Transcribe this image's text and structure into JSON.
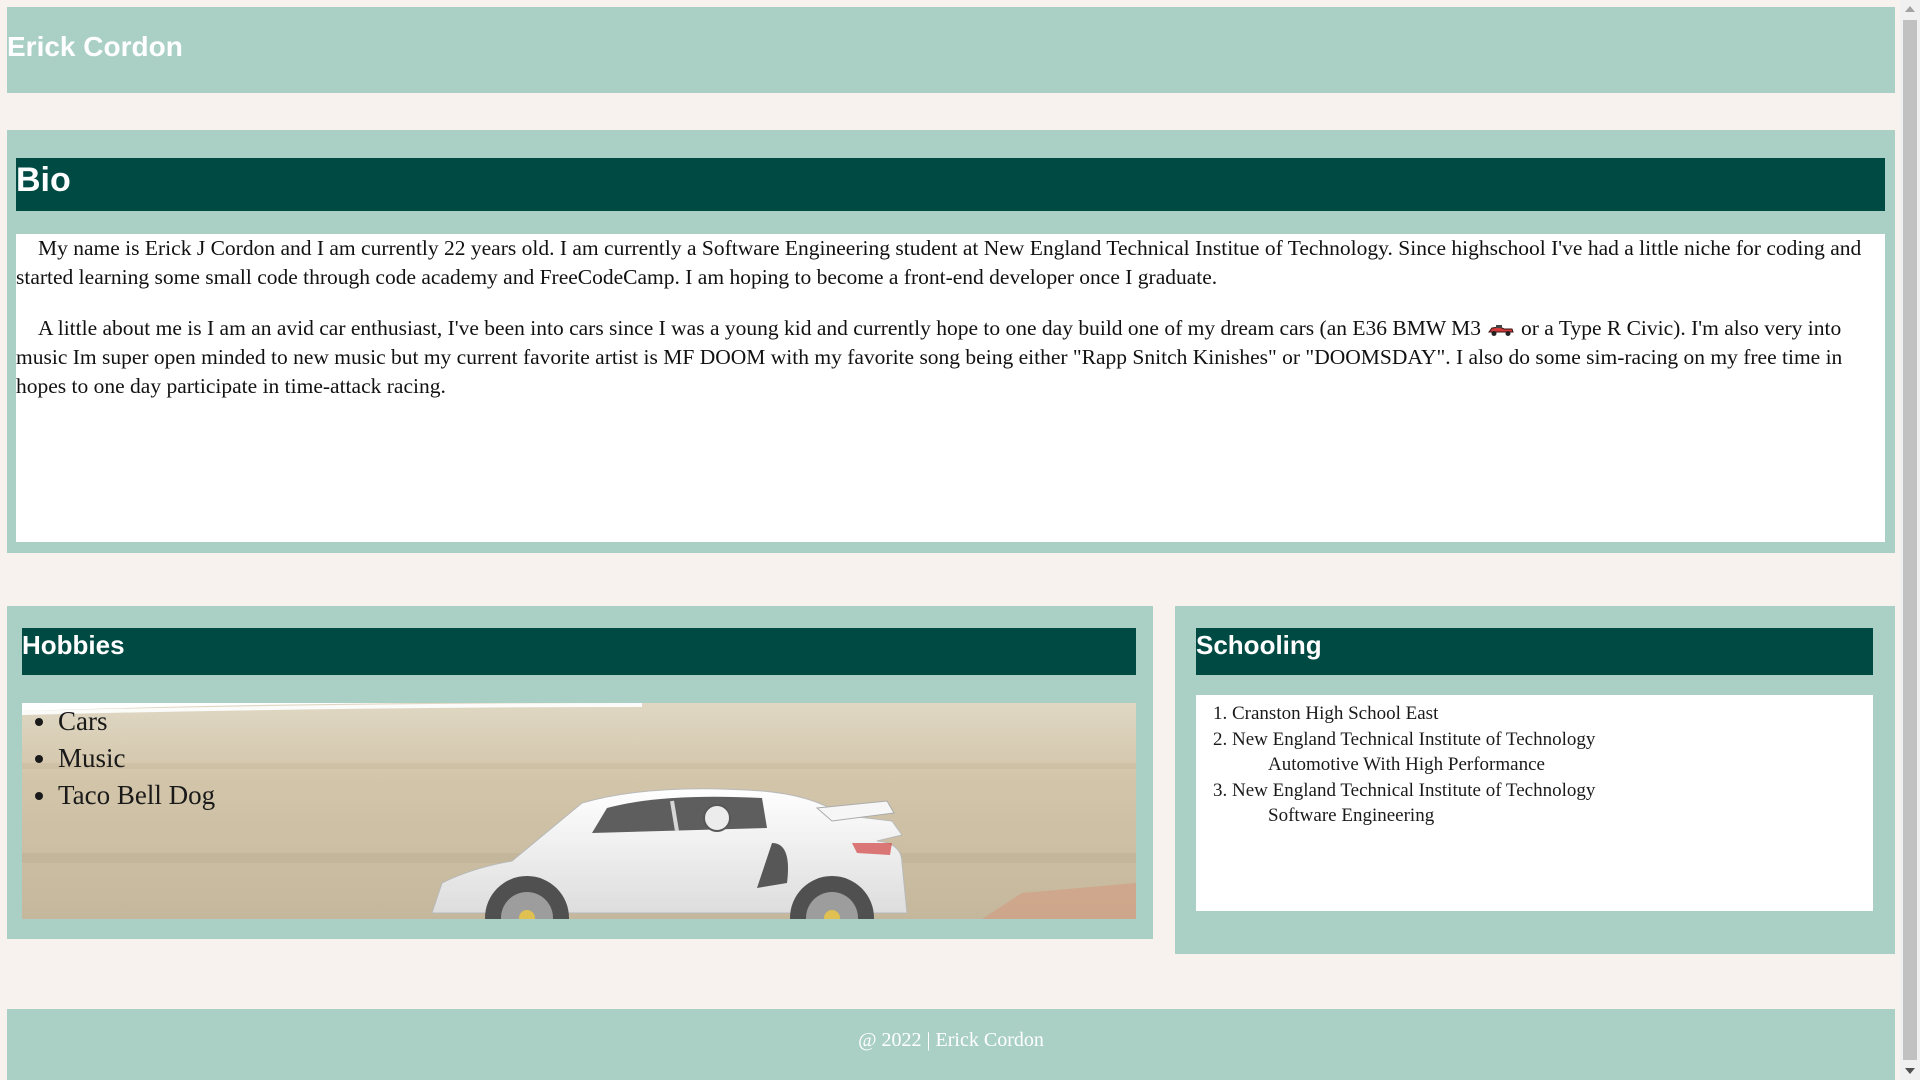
{
  "header": {
    "title": "Erick Cordon"
  },
  "bio": {
    "heading": "Bio",
    "paragraph1": "My name is Erick J Cordon and I am currently 22 years old. I am currently a Software Engineering student at New England Technical Institue of Technology. Since highschool I've had a little niche for coding and started learning some small code through code academy and FreeCodeCamp. I am hoping to become a front-end developer once I graduate.",
    "paragraph2_before": "A little about me is I am an avid car enthusiast, I've been into cars since I was a young kid and currently hope to one day build one of my dream cars (an E36 BMW M3",
    "paragraph2_after": "or a Type R Civic). I'm also very into music Im super open minded to new music but my current favorite artist is MF DOOM with my favorite song being either \"Rapp Snitch Kinishes\" or \"DOOMSDAY\". I also do some sim-racing on my free time in hopes to one day participate in time-attack racing.",
    "inline_icon": "race-car-icon"
  },
  "hobbies": {
    "heading": "Hobbies",
    "items": [
      "Cars",
      "Music",
      "Taco Bell Dog"
    ],
    "background_image": "white-porsche-race-car-photo"
  },
  "schooling": {
    "heading": "Schooling",
    "items": [
      {
        "school": "Cranston High School East",
        "program": ""
      },
      {
        "school": "New England Technical Institute of Technology",
        "program": "Automotive With High Performance"
      },
      {
        "school": "New England Technical Institute of Technology",
        "program": "Software Engineering"
      }
    ]
  },
  "footer": {
    "text": "@ 2022 | Erick Cordon"
  },
  "colors": {
    "page_background": "#f7f2ee",
    "section_background": "#aad0c5",
    "heading_bar": "#004a44",
    "text_light": "#ffffff"
  }
}
